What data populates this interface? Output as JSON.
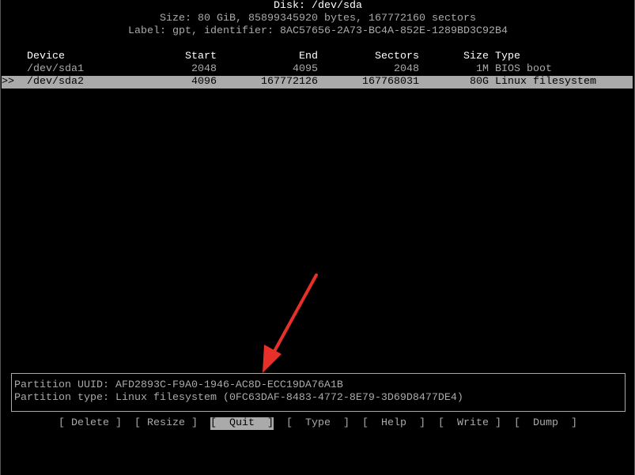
{
  "header": {
    "title": "Disk: /dev/sda",
    "size_line": "Size: 80 GiB, 85899345920 bytes, 167772160 sectors",
    "label_line": "Label: gpt, identifier: 8AC57656-2A73-BC4A-852E-1289BD3C92B4"
  },
  "table": {
    "columns": [
      "Device",
      "Start",
      "End",
      "Sectors",
      "Size",
      "Type"
    ],
    "rows": [
      {
        "marker": "",
        "device": "/dev/sda1",
        "start": "2048",
        "end": "4095",
        "sectors": "2048",
        "size": "1M",
        "type": "BIOS boot",
        "selected": false
      },
      {
        "marker": ">>",
        "device": "/dev/sda2",
        "start": "4096",
        "end": "167772126",
        "sectors": "167768031",
        "size": "80G",
        "type": "Linux filesystem",
        "selected": true
      }
    ]
  },
  "info": {
    "uuid_line": "Partition UUID: AFD2893C-F9A0-1946-AC8D-ECC19DA76A1B",
    "type_line": "Partition type: Linux filesystem (0FC63DAF-8483-4772-8E79-3D69D8477DE4)"
  },
  "buttons": [
    {
      "label": "[ Delete ]",
      "active": false
    },
    {
      "label": "[ Resize ]",
      "active": false
    },
    {
      "label": "[  Quit  ]",
      "active": true
    },
    {
      "label": "[  Type  ]",
      "active": false
    },
    {
      "label": "[  Help  ]",
      "active": false
    },
    {
      "label": "[  Write ]",
      "active": false
    },
    {
      "label": "[  Dump  ]",
      "active": false
    }
  ],
  "annotation": {
    "arrow_color": "#e8302a"
  },
  "colors": {
    "text": "#aaaaaa",
    "highlight": "#aaaaaa",
    "background": "#000000"
  }
}
